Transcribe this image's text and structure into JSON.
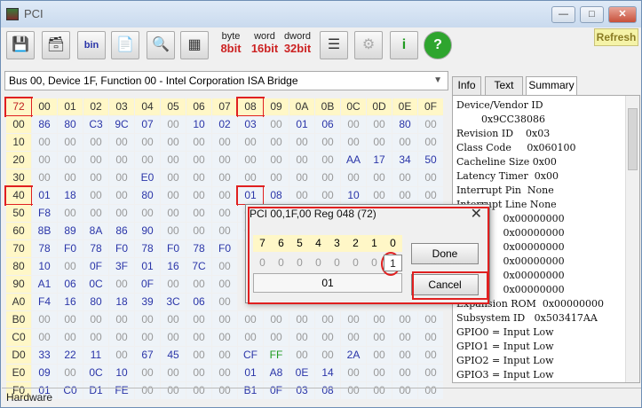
{
  "window": {
    "title": "PCI"
  },
  "toolbar": {
    "byte_top": "byte",
    "byte_bot": "8bit",
    "word_top": "word",
    "word_bot": "16bit",
    "dword_top": "dword",
    "dword_bot": "32bit",
    "bin_label": "bin",
    "refresh_label": "Refresh"
  },
  "device_select": {
    "value": "Bus 00, Device 1F, Function 00 - Intel Corporation ISA Bridge"
  },
  "grid": {
    "corner": "72",
    "col_headers": [
      "00",
      "01",
      "02",
      "03",
      "04",
      "05",
      "06",
      "07",
      "08",
      "09",
      "0A",
      "0B",
      "0C",
      "0D",
      "0E",
      "0F"
    ],
    "rows": [
      {
        "label": "00",
        "cells": [
          "86",
          "80",
          "C3",
          "9C",
          "07",
          "00",
          "10",
          "02",
          "03",
          "00",
          "01",
          "06",
          "00",
          "00",
          "80",
          "00"
        ]
      },
      {
        "label": "10",
        "cells": [
          "00",
          "00",
          "00",
          "00",
          "00",
          "00",
          "00",
          "00",
          "00",
          "00",
          "00",
          "00",
          "00",
          "00",
          "00",
          "00"
        ]
      },
      {
        "label": "20",
        "cells": [
          "00",
          "00",
          "00",
          "00",
          "00",
          "00",
          "00",
          "00",
          "00",
          "00",
          "00",
          "00",
          "AA",
          "17",
          "34",
          "50"
        ]
      },
      {
        "label": "30",
        "cells": [
          "00",
          "00",
          "00",
          "00",
          "E0",
          "00",
          "00",
          "00",
          "00",
          "00",
          "00",
          "00",
          "00",
          "00",
          "00",
          "00"
        ]
      },
      {
        "label": "40",
        "cells": [
          "01",
          "18",
          "00",
          "00",
          "80",
          "00",
          "00",
          "00",
          "01",
          "08",
          "00",
          "00",
          "10",
          "00",
          "00",
          "00"
        ]
      },
      {
        "label": "50",
        "cells": [
          "F8",
          "00",
          "00",
          "00",
          "00",
          "00",
          "00",
          "00",
          "00",
          "",
          "",
          "",
          "",
          "",
          "",
          ""
        ]
      },
      {
        "label": "60",
        "cells": [
          "8B",
          "89",
          "8A",
          "86",
          "90",
          "00",
          "00",
          "00",
          "00",
          "",
          "",
          "",
          "",
          "",
          "",
          ""
        ]
      },
      {
        "label": "70",
        "cells": [
          "78",
          "F0",
          "78",
          "F0",
          "78",
          "F0",
          "78",
          "F0",
          "",
          "",
          "",
          "",
          "",
          "",
          "",
          ""
        ]
      },
      {
        "label": "80",
        "cells": [
          "10",
          "00",
          "0F",
          "3F",
          "01",
          "16",
          "7C",
          "00",
          "",
          "",
          "",
          "",
          "",
          "",
          "",
          ""
        ]
      },
      {
        "label": "90",
        "cells": [
          "A1",
          "06",
          "0C",
          "00",
          "0F",
          "00",
          "00",
          "00",
          "",
          "",
          "",
          "",
          "",
          "",
          "",
          ""
        ]
      },
      {
        "label": "A0",
        "cells": [
          "F4",
          "16",
          "80",
          "18",
          "39",
          "3C",
          "06",
          "00",
          "",
          "",
          "",
          "",
          "",
          "",
          "",
          ""
        ]
      },
      {
        "label": "B0",
        "cells": [
          "00",
          "00",
          "00",
          "00",
          "00",
          "00",
          "00",
          "00",
          "00",
          "00",
          "00",
          "00",
          "00",
          "00",
          "00",
          "00"
        ]
      },
      {
        "label": "C0",
        "cells": [
          "00",
          "00",
          "00",
          "00",
          "00",
          "00",
          "00",
          "00",
          "00",
          "00",
          "00",
          "00",
          "00",
          "00",
          "00",
          "00"
        ]
      },
      {
        "label": "D0",
        "cells": [
          "33",
          "22",
          "11",
          "00",
          "67",
          "45",
          "00",
          "00",
          "CF",
          "FF",
          "00",
          "00",
          "2A",
          "00",
          "00",
          "00"
        ]
      },
      {
        "label": "E0",
        "cells": [
          "09",
          "00",
          "0C",
          "10",
          "00",
          "00",
          "00",
          "00",
          "01",
          "A8",
          "0E",
          "14",
          "00",
          "00",
          "00",
          "00"
        ]
      },
      {
        "label": "F0",
        "cells": [
          "01",
          "C0",
          "D1",
          "FE",
          "00",
          "00",
          "00",
          "00",
          "B1",
          "0F",
          "03",
          "08",
          "00",
          "00",
          "00",
          "00"
        ]
      }
    ]
  },
  "tabs": [
    "Info",
    "Text",
    "Summary"
  ],
  "summary": [
    "Device/Vendor ID",
    "        0x9CC38086",
    "Revision ID    0x03",
    "Class Code     0x060100",
    "Cacheline Size 0x00",
    "Latency Timer  0x00",
    "Interrupt Pin  None",
    "Interrupt Line None",
    "               0x00000000",
    "               0x00000000",
    "               0x00000000",
    "               0x00000000",
    "               0x00000000",
    "               0x00000000",
    "Expansion ROM  0x00000000",
    "Subsystem ID   0x503417AA",
    "GPIO0 = Input Low",
    "GPIO1 = Input Low",
    "GPIO2 = Input Low",
    "GPIO3 = Input Low"
  ],
  "status": {
    "text": "Hardware"
  },
  "dialog": {
    "title": "PCI 00,1F,00 Reg 048 (72)",
    "bit_headers": [
      "7",
      "6",
      "5",
      "4",
      "3",
      "2",
      "1",
      "0"
    ],
    "bit_values": [
      "0",
      "0",
      "0",
      "0",
      "0",
      "0",
      "0",
      "1"
    ],
    "byte_value": "01",
    "done_label": "Done",
    "cancel_label": "Cancel"
  },
  "colors": {
    "highlight": "#e02020",
    "value_blue": "#2a35a8",
    "header_yellow": "#fff7c7"
  }
}
